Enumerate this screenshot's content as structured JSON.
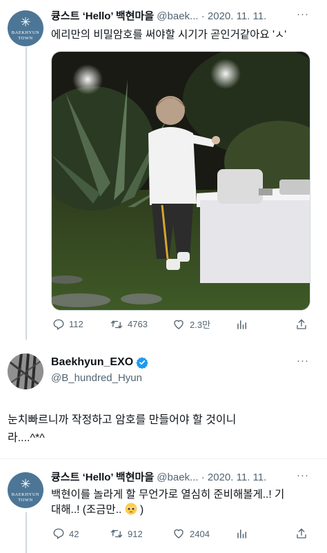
{
  "tweet1": {
    "display_name": "큥스트 ‘Hello’ 백현마을",
    "handle": "@baek...",
    "date": "· 2020. 11. 11.",
    "text": "에리만의 비밀암호를 써야할 시기가 곧인거같아요 'ㅅ'",
    "replies": "112",
    "retweets": "4763",
    "likes": "2.3만",
    "avatar_text": "BAEKHYUN TOWN"
  },
  "tweet2": {
    "display_name": "Baekhyun_EXO",
    "handle": "@B_hundred_Hyun",
    "text_line1": "눈치빠르니까 작정하고 암호를 만들어야 할 것이니",
    "text_line2": "라....^*^"
  },
  "tweet3": {
    "display_name": "큥스트 ‘Hello’ 백현마을",
    "handle": "@baek...",
    "date": "· 2020. 11. 11.",
    "text_line1": "백현이를 놀라게 할 무언가로 열심히 준비해볼게..! 기",
    "text_line2": "대해..! (조금만..",
    "text_line2_end": ")",
    "replies": "42",
    "retweets": "912",
    "likes": "2404",
    "avatar_text": "BAEKHYUN TOWN"
  },
  "icons": [
    "reply-icon",
    "retweet-icon",
    "like-icon",
    "views-icon",
    "share-icon",
    "more-icon",
    "verified-badge-icon",
    "pleading-face-emoji"
  ],
  "colors": {
    "accent": "#1d9bf0",
    "muted": "#536471",
    "text": "#0f1419",
    "thread_line": "#cfd9de",
    "avatar_village": "#4d7696"
  }
}
